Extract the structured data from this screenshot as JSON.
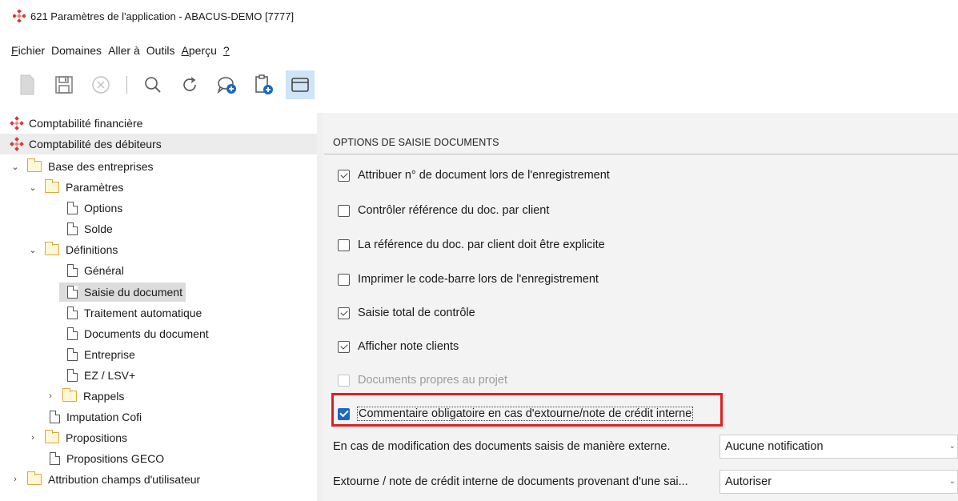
{
  "window": {
    "title": "621 Paramètres de l'application - ABACUS-DEMO [7777]"
  },
  "menu": [
    {
      "label_under": "F",
      "label_rest": "ichier"
    },
    {
      "label_under": "",
      "label_rest": "Domaines"
    },
    {
      "label_under": "",
      "label_rest": "Aller à"
    },
    {
      "label_under": "",
      "label_rest": "Outils"
    },
    {
      "label_under": "A",
      "label_rest": "perçu"
    },
    {
      "label_under": "?",
      "label_rest": ""
    }
  ],
  "tree": {
    "items": [
      {
        "label": "Comptabilité financière",
        "icon": "abacus-icon"
      },
      {
        "label": "Comptabilité des débiteurs",
        "icon": "abacus-icon"
      },
      {
        "label": "Base des entreprises",
        "icon": "folder-icon",
        "expander": "expanded"
      },
      {
        "label": "Paramètres",
        "icon": "folder-icon",
        "expander": "expanded"
      },
      {
        "label": "Options",
        "icon": "document-icon"
      },
      {
        "label": "Solde",
        "icon": "document-icon"
      },
      {
        "label": "Définitions",
        "icon": "folder-icon",
        "expander": "expanded"
      },
      {
        "label": "Général",
        "icon": "document-icon"
      },
      {
        "label": "Saisie du document",
        "icon": "document-icon",
        "selected": true
      },
      {
        "label": "Traitement automatique",
        "icon": "document-icon"
      },
      {
        "label": "Documents du document",
        "icon": "document-icon"
      },
      {
        "label": "Entreprise",
        "icon": "document-icon"
      },
      {
        "label": "EZ / LSV+",
        "icon": "document-icon"
      },
      {
        "label": "Rappels",
        "icon": "folder-icon",
        "expander": "collapsed"
      },
      {
        "label": "Imputation Cofi",
        "icon": "document-icon"
      },
      {
        "label": "Propositions",
        "icon": "folder-icon",
        "expander": "collapsed"
      },
      {
        "label": "Propositions GECO",
        "icon": "document-icon"
      },
      {
        "label": "Attribution champs d'utilisateur",
        "icon": "folder-icon",
        "expander": "collapsed"
      }
    ]
  },
  "section": {
    "title": "OPTIONS DE SAISIE DOCUMENTS"
  },
  "options": [
    {
      "label": "Attribuer n° de document lors de l'enregistrement",
      "checked": true
    },
    {
      "label": "Contrôler référence du doc. par client",
      "checked": false
    },
    {
      "label": "La référence du doc. par client doit être explicite",
      "checked": false
    },
    {
      "label": "Imprimer le code-barre lors de l'enregistrement",
      "checked": false
    },
    {
      "label": "Saisie total de contrôle",
      "checked": true
    },
    {
      "label": "Afficher note clients",
      "checked": true
    },
    {
      "label": "Documents propres au projet",
      "checked": false,
      "disabled": true
    },
    {
      "label": "Commentaire obligatoire en cas d'extourne/note de crédit interne",
      "checked": true,
      "highlighted": true
    }
  ],
  "fields": [
    {
      "label": "En cas de modification des documents saisis de manière externe.",
      "value": "Aucune notification"
    },
    {
      "label": "Extourne / note de crédit interne de documents provenant d'une sai...",
      "value": "Autoriser"
    }
  ],
  "colors": {
    "highlight_border": "#e02020",
    "checkbox_blue": "#1f66c2",
    "toolbar_active": "#cfe4f7"
  }
}
